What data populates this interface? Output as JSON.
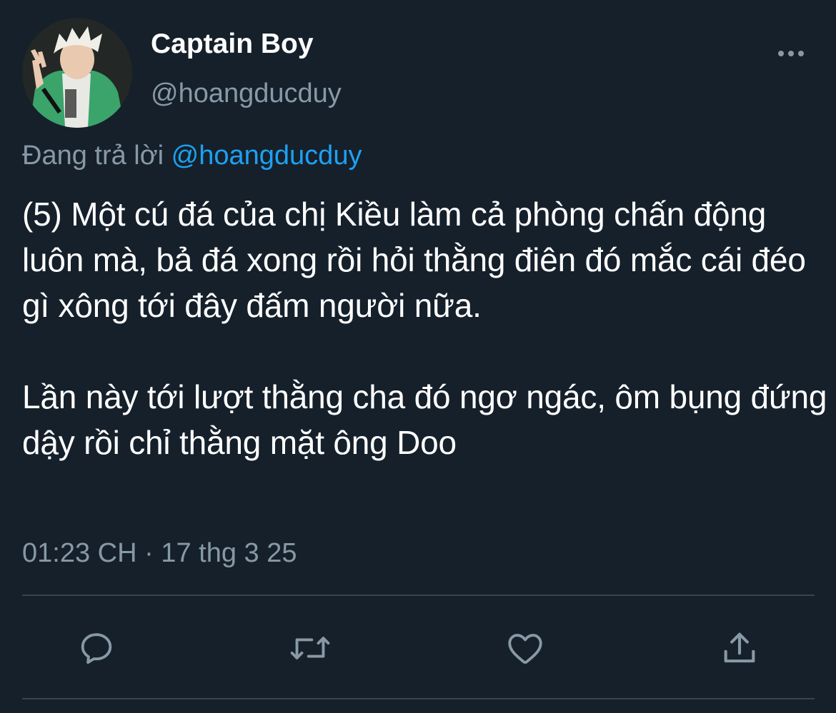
{
  "tweet": {
    "display_name": "Captain Boy",
    "handle": "@hoangducduy",
    "reply_prefix": "Đang trả lời",
    "reply_mention": "@hoangducduy",
    "body": "(5) Một cú đá của chị Kiều làm cả phòng chấn động luôn mà, bả đá xong rồi hỏi thằng điên đó mắc cái đéo gì xông tới đây đấm người nữa.\n\nLần này tới lượt thằng cha đó ngơ ngác, ôm bụng đứng dậy rồi chỉ thằng mặt ông Doo",
    "timestamp": "01:23 CH · 17 thg 3 25"
  },
  "icons": {
    "more": "more-horizontal-icon",
    "reply": "reply-icon",
    "retweet": "retweet-icon",
    "like": "heart-icon",
    "share": "share-icon"
  },
  "colors": {
    "background": "#15202b",
    "primary_text": "#ffffff",
    "secondary_text": "#8899a6",
    "accent": "#1da1f2",
    "divider": "#38444d"
  }
}
